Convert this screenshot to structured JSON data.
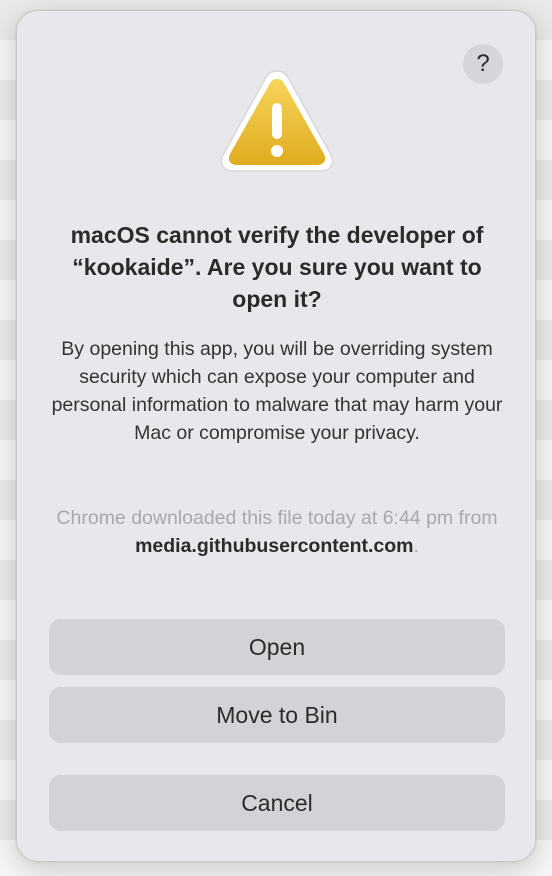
{
  "dialog": {
    "help_label": "?",
    "title": "macOS cannot verify the developer of “kookaide”. Are you sure you want to open it?",
    "message": "By opening this app, you will be overriding system security which can expose your computer and personal information to malware that may harm your Mac or compromise your privacy.",
    "source_prefix": "Chrome downloaded this file today at 6:44 pm from",
    "source_domain": "media.githubusercontent.com",
    "source_suffix": ".",
    "icon": "warning-triangle-icon",
    "buttons": {
      "open": "Open",
      "move_to_bin": "Move to Bin",
      "cancel": "Cancel"
    }
  },
  "colors": {
    "warning_yellow": "#f2c94c",
    "warning_border": "#ffffff",
    "dialog_background": "#e8e7ec",
    "button_background": "#d3d2d7"
  }
}
